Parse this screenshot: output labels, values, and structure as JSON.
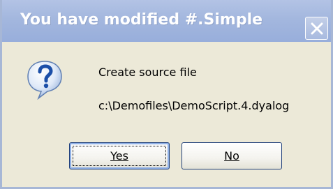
{
  "window": {
    "title": "You have modified #.Simple"
  },
  "dialog": {
    "icon": "question-icon",
    "message_line_1": "Create source file",
    "message_line_2": "c:\\Demofiles\\DemoScript.4.dyalog"
  },
  "buttons": {
    "yes_label": "Yes",
    "no_label": "No"
  },
  "colors": {
    "titlebar": "#a3b7de",
    "client_background": "#ece9d8",
    "button_border": "#1f3f7a",
    "icon_blue": "#1c4fa8"
  }
}
